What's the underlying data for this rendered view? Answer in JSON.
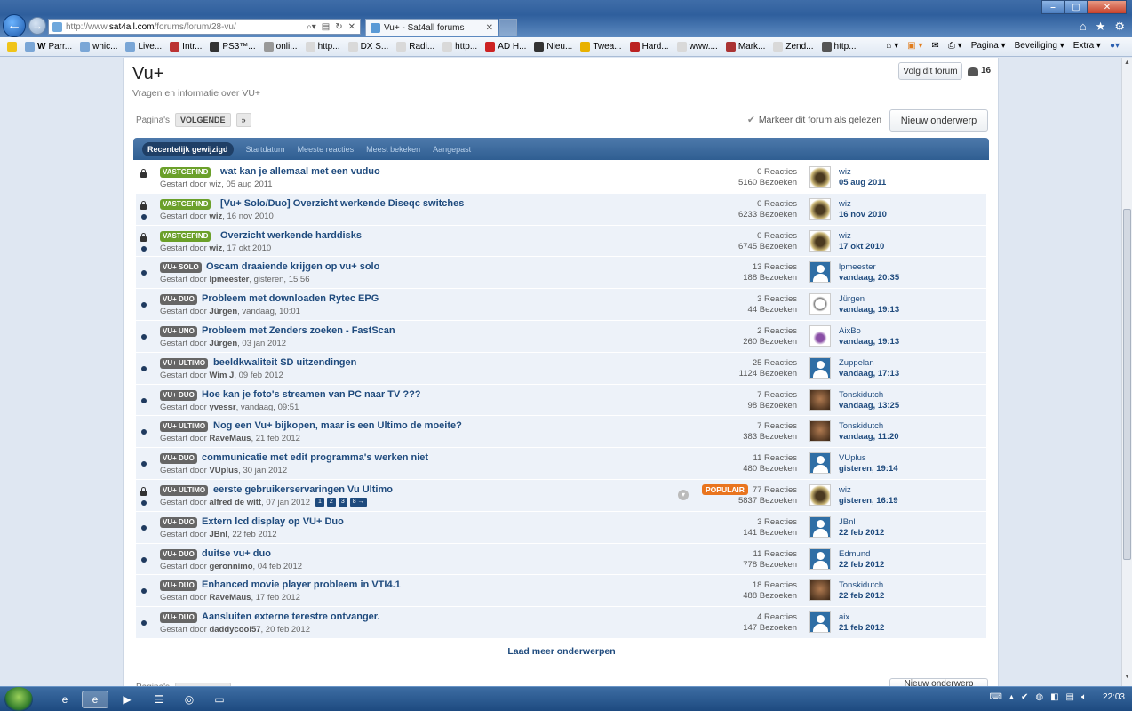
{
  "browser": {
    "url_prefix": "http://www.",
    "url_host": "sat4all.com",
    "url_path": "/forums/forum/28-vu/",
    "tab_title": "Vu+ - Sat4all forums",
    "favorites": [
      "Parr...",
      "whic...",
      "Live...",
      "Intr...",
      "PS3™...",
      "onli...",
      "http...",
      "DX S...",
      "Radi...",
      "http...",
      "AD H...",
      "Nieu...",
      "Twea...",
      "Hard...",
      "www....",
      "Mark...",
      "Zend...",
      "http..."
    ],
    "cmd": {
      "page": "Pagina ▾",
      "security": "Beveiliging ▾",
      "extra": "Extra ▾"
    }
  },
  "forum": {
    "title": "Vu+",
    "description": "Vragen en informatie over VU+",
    "follow_label": "Volg dit forum",
    "follow_count": "16",
    "pages_label": "Pagina's",
    "next_label": "VOLGENDE",
    "next_arrow": "»",
    "mark_read": "Markeer dit forum als gelezen",
    "new_topic": "Nieuw onderwerp",
    "load_more": "Laad meer onderwerpen"
  },
  "sort_tabs": [
    "Recentelijk gewijzigd",
    "Startdatum",
    "Meeste reacties",
    "Meest bekeken",
    "Aangepast"
  ],
  "topics": [
    {
      "prefix": "VASTGEPIND",
      "title": "wat kan je allemaal met een vuduo",
      "starter_prefix": "Gestart door ",
      "starter": "wiz",
      "started": ", 05 aug 2011",
      "replies": "0 Reacties",
      "views": "5160 Bezoeken",
      "last_user": "wiz",
      "last_date": "05 aug 2011"
    },
    {
      "prefix": "VASTGEPIND",
      "title": "[Vu+ Solo/Duo] Overzicht werkende Diseqc switches",
      "starter_prefix": "Gestart door ",
      "starter": "wiz",
      "started": ", 16 nov 2010",
      "replies": "0 Reacties",
      "views": "6233 Bezoeken",
      "last_user": "wiz",
      "last_date": "16 nov 2010"
    },
    {
      "prefix": "VASTGEPIND",
      "title": "Overzicht werkende harddisks",
      "starter_prefix": "Gestart door ",
      "starter": "wiz",
      "started": ", 17 okt 2010",
      "replies": "0 Reacties",
      "views": "6745 Bezoeken",
      "last_user": "wiz",
      "last_date": "17 okt 2010"
    },
    {
      "prefix": "VU+ SOLO",
      "title": "Oscam draaiende krijgen op vu+ solo",
      "starter_prefix": "Gestart door ",
      "starter": "lpmeester",
      "started": ", gisteren, 15:56",
      "replies": "13 Reacties",
      "views": "188 Bezoeken",
      "last_user": "lpmeester",
      "last_date": "vandaag, 20:35"
    },
    {
      "prefix": "VU+ DUO",
      "title": "Probleem met downloaden Rytec EPG",
      "starter_prefix": "Gestart door ",
      "starter": "Jürgen",
      "started": ", vandaag, 10:01",
      "replies": "3 Reacties",
      "views": "44 Bezoeken",
      "last_user": "Jürgen",
      "last_date": "vandaag, 19:13"
    },
    {
      "prefix": "VU+ UNO",
      "title": "Probleem met Zenders zoeken - FastScan",
      "starter_prefix": "Gestart door ",
      "starter": "Jürgen",
      "started": ", 03 jan 2012",
      "replies": "2 Reacties",
      "views": "260 Bezoeken",
      "last_user": "AixBo",
      "last_date": "vandaag, 19:13"
    },
    {
      "prefix": "VU+ ULTIMO",
      "title": "beeldkwaliteit SD uitzendingen",
      "starter_prefix": "Gestart door ",
      "starter": "Wim J",
      "started": ", 09 feb 2012",
      "replies": "25 Reacties",
      "views": "1124 Bezoeken",
      "last_user": "Zuppelan",
      "last_date": "vandaag, 17:13"
    },
    {
      "prefix": "VU+ DUO",
      "title": "Hoe kan je foto's streamen van PC naar TV ???",
      "starter_prefix": "Gestart door ",
      "starter": "yvessr",
      "started": ", vandaag, 09:51",
      "replies": "7 Reacties",
      "views": "98 Bezoeken",
      "last_user": "Tonskidutch",
      "last_date": "vandaag, 13:25"
    },
    {
      "prefix": "VU+ ULTIMO",
      "title": "Nog een Vu+ bijkopen, maar is een Ultimo de moeite?",
      "starter_prefix": "Gestart door ",
      "starter": "RaveMaus",
      "started": ", 21 feb 2012",
      "replies": "7 Reacties",
      "views": "383 Bezoeken",
      "last_user": "Tonskidutch",
      "last_date": "vandaag, 11:20"
    },
    {
      "prefix": "VU+ DUO",
      "title": "communicatie met edit programma's werken niet",
      "starter_prefix": "Gestart door ",
      "starter": "VUplus",
      "started": ", 30 jan 2012",
      "replies": "11 Reacties",
      "views": "480 Bezoeken",
      "last_user": "VUplus",
      "last_date": "gisteren, 19:14"
    },
    {
      "prefix": "VU+ ULTIMO",
      "title": "eerste gebruikerservaringen Vu Ultimo",
      "starter_prefix": "Gestart door ",
      "starter": "alfred de witt",
      "started": ", 07 jan 2012",
      "replies": "77 Reacties",
      "views": "5837 Bezoeken",
      "last_user": "wiz",
      "last_date": "gisteren, 16:19",
      "popular": "POPULAIR",
      "pages": [
        "1",
        "2",
        "3",
        "8 →"
      ]
    },
    {
      "prefix": "VU+ DUO",
      "title": "Extern lcd display op VU+ Duo",
      "starter_prefix": "Gestart door ",
      "starter": "JBnl",
      "started": ", 22 feb 2012",
      "replies": "3 Reacties",
      "views": "141 Bezoeken",
      "last_user": "JBnl",
      "last_date": "22 feb 2012"
    },
    {
      "prefix": "VU+ DUO",
      "title": "duitse vu+ duo",
      "starter_prefix": "Gestart door ",
      "starter": "geronnimo",
      "started": ", 04 feb 2012",
      "replies": "11 Reacties",
      "views": "778 Bezoeken",
      "last_user": "Edmund",
      "last_date": "22 feb 2012"
    },
    {
      "prefix": "VU+ DUO",
      "title": "Enhanced movie player probleem in VTI4.1",
      "starter_prefix": "Gestart door ",
      "starter": "RaveMaus",
      "started": ", 17 feb 2012",
      "replies": "18 Reacties",
      "views": "488 Bezoeken",
      "last_user": "Tonskidutch",
      "last_date": "22 feb 2012"
    },
    {
      "prefix": "VU+ DUO",
      "title": "Aansluiten externe terestre ontvanger.",
      "starter_prefix": "Gestart door ",
      "starter": "daddycool57",
      "started": ", 20 feb 2012",
      "replies": "4 Reacties",
      "views": "147 Bezoeken",
      "last_user": "aix",
      "last_date": "21 feb 2012"
    }
  ],
  "taskbar": {
    "clock": "22:03"
  }
}
